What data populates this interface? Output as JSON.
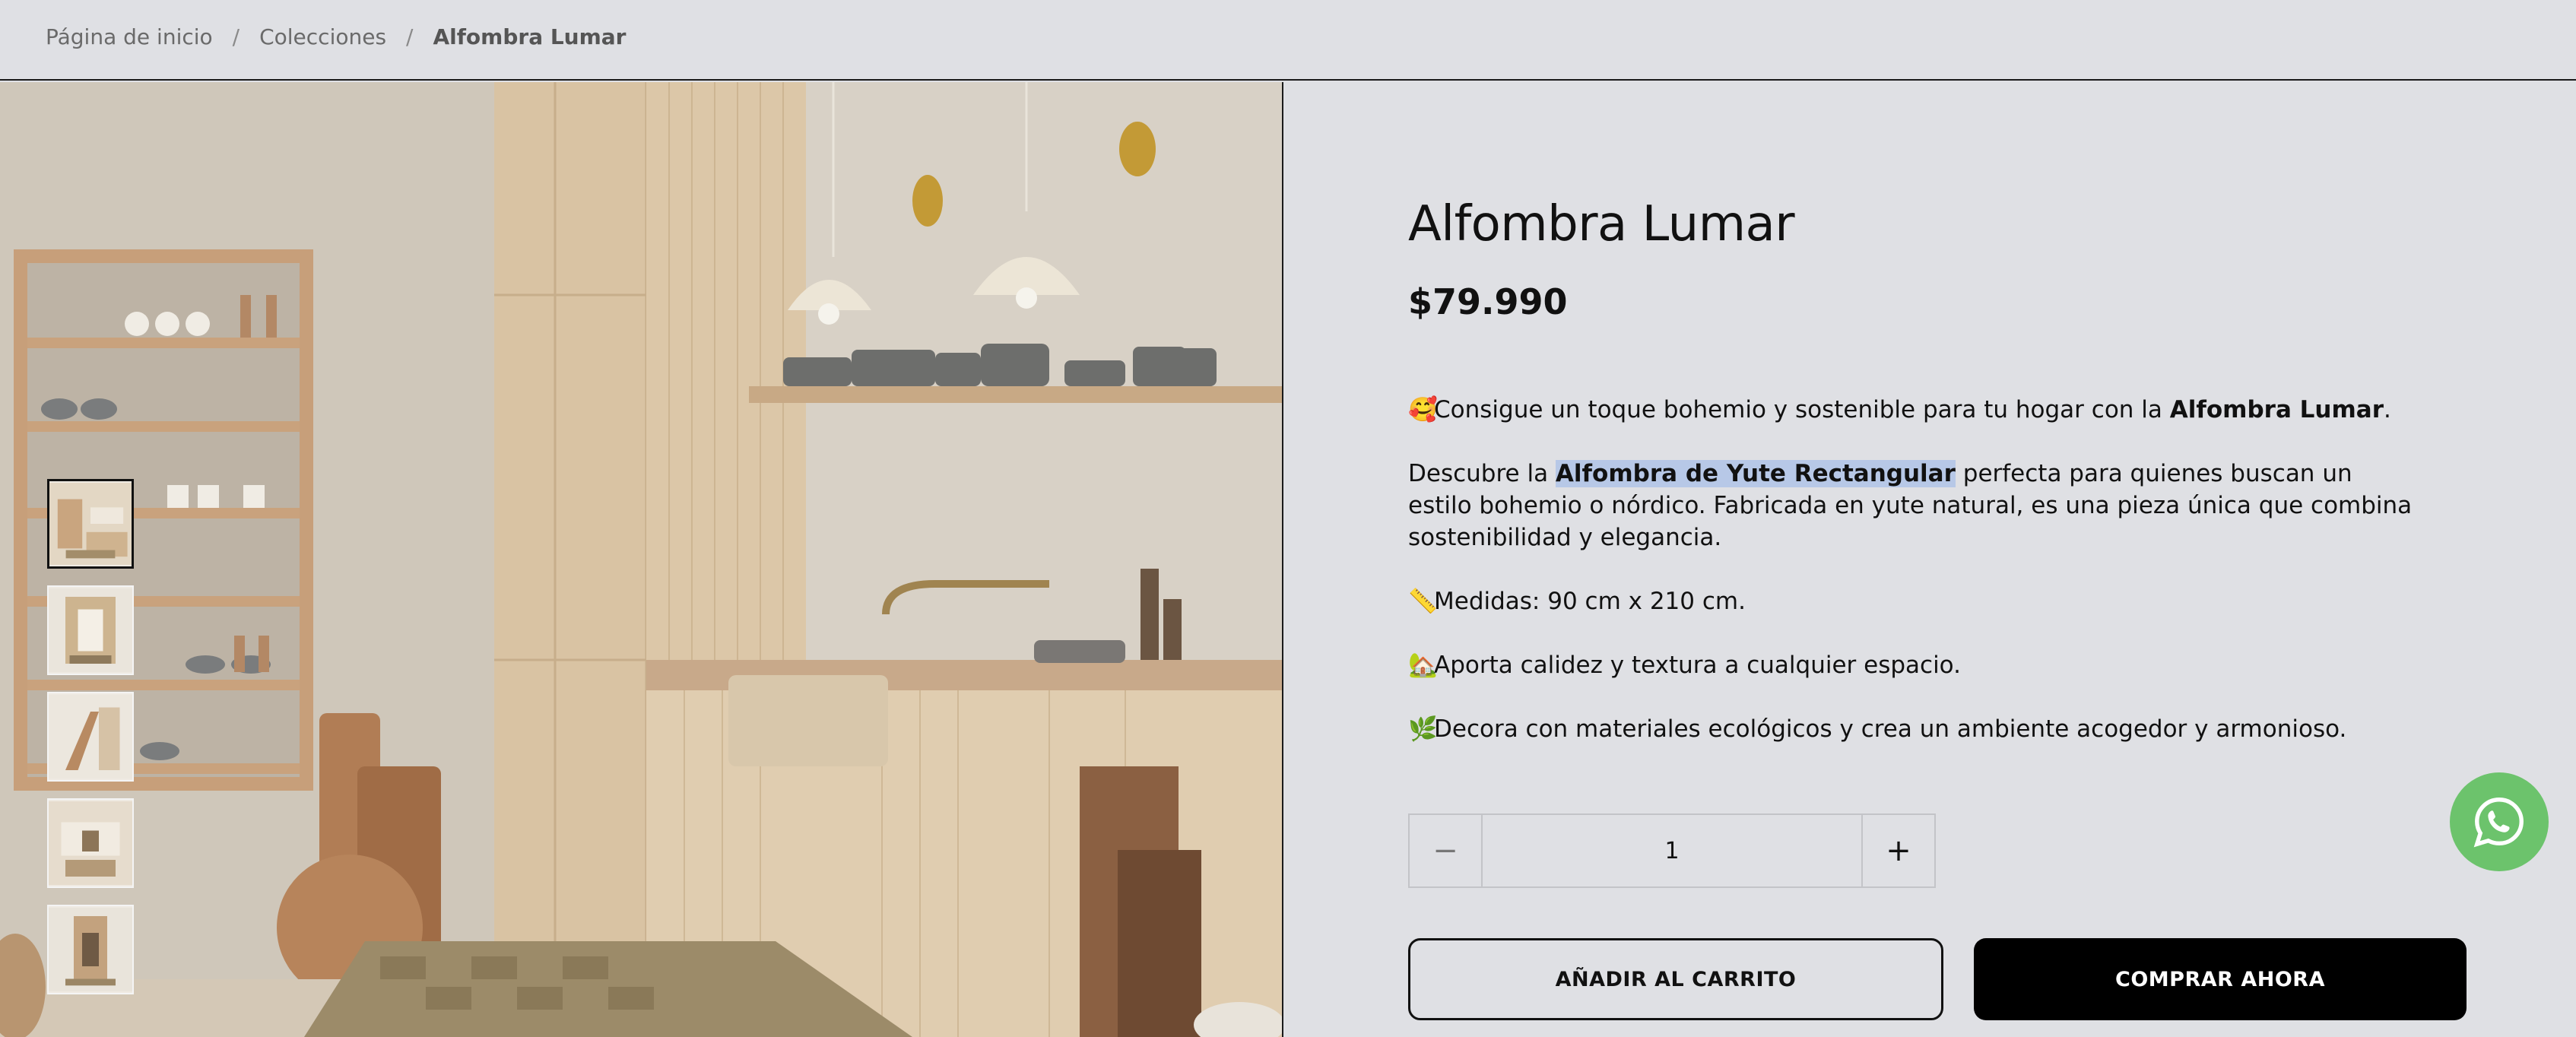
{
  "breadcrumb": {
    "home": "Página de inicio",
    "separator": "/",
    "collections": "Colecciones",
    "current": "Alfombra Lumar"
  },
  "gallery": {
    "thumbnails": [
      {
        "name": "thumb-1",
        "active": true
      },
      {
        "name": "thumb-2",
        "active": false
      },
      {
        "name": "thumb-3",
        "active": false
      },
      {
        "name": "thumb-4",
        "active": false
      },
      {
        "name": "thumb-5",
        "active": false
      }
    ]
  },
  "product": {
    "title": "Alfombra Lumar",
    "price": "$79.990",
    "intro_emoji": "🥰",
    "intro_text": "Consigue un toque bohemio y sostenible para tu hogar con la ",
    "intro_bold": "Alfombra Lumar",
    "intro_end": ".",
    "para2_start": "Descubre la ",
    "para2_highlight": "Alfombra de Yute Rectangular",
    "para2_rest": " perfecta para quienes buscan un estilo bohemio o nórdico. Fabricada en yute natural, es una pieza única que combina sostenibilidad y elegancia.",
    "bullets": [
      {
        "emoji": "📏",
        "text": "Medidas: 90 cm x 210 cm."
      },
      {
        "emoji": "🏡",
        "text": "Aporta calidez y textura a cualquier espacio."
      },
      {
        "emoji": "🌿",
        "text": "Decora con materiales ecológicos y crea un ambiente acogedor y armonioso."
      }
    ]
  },
  "quantity": {
    "minus": "−",
    "value": "1",
    "plus": "+"
  },
  "actions": {
    "add_to_cart": "AÑADIR AL CARRITO",
    "buy_now": "COMPRAR AHORA"
  },
  "colors": {
    "background": "#dfe0e4",
    "buy_button": "#000000",
    "whatsapp": "#6cc36c",
    "highlight": "#b7c8e7"
  },
  "icons": {
    "whatsapp": "whatsapp-icon"
  }
}
